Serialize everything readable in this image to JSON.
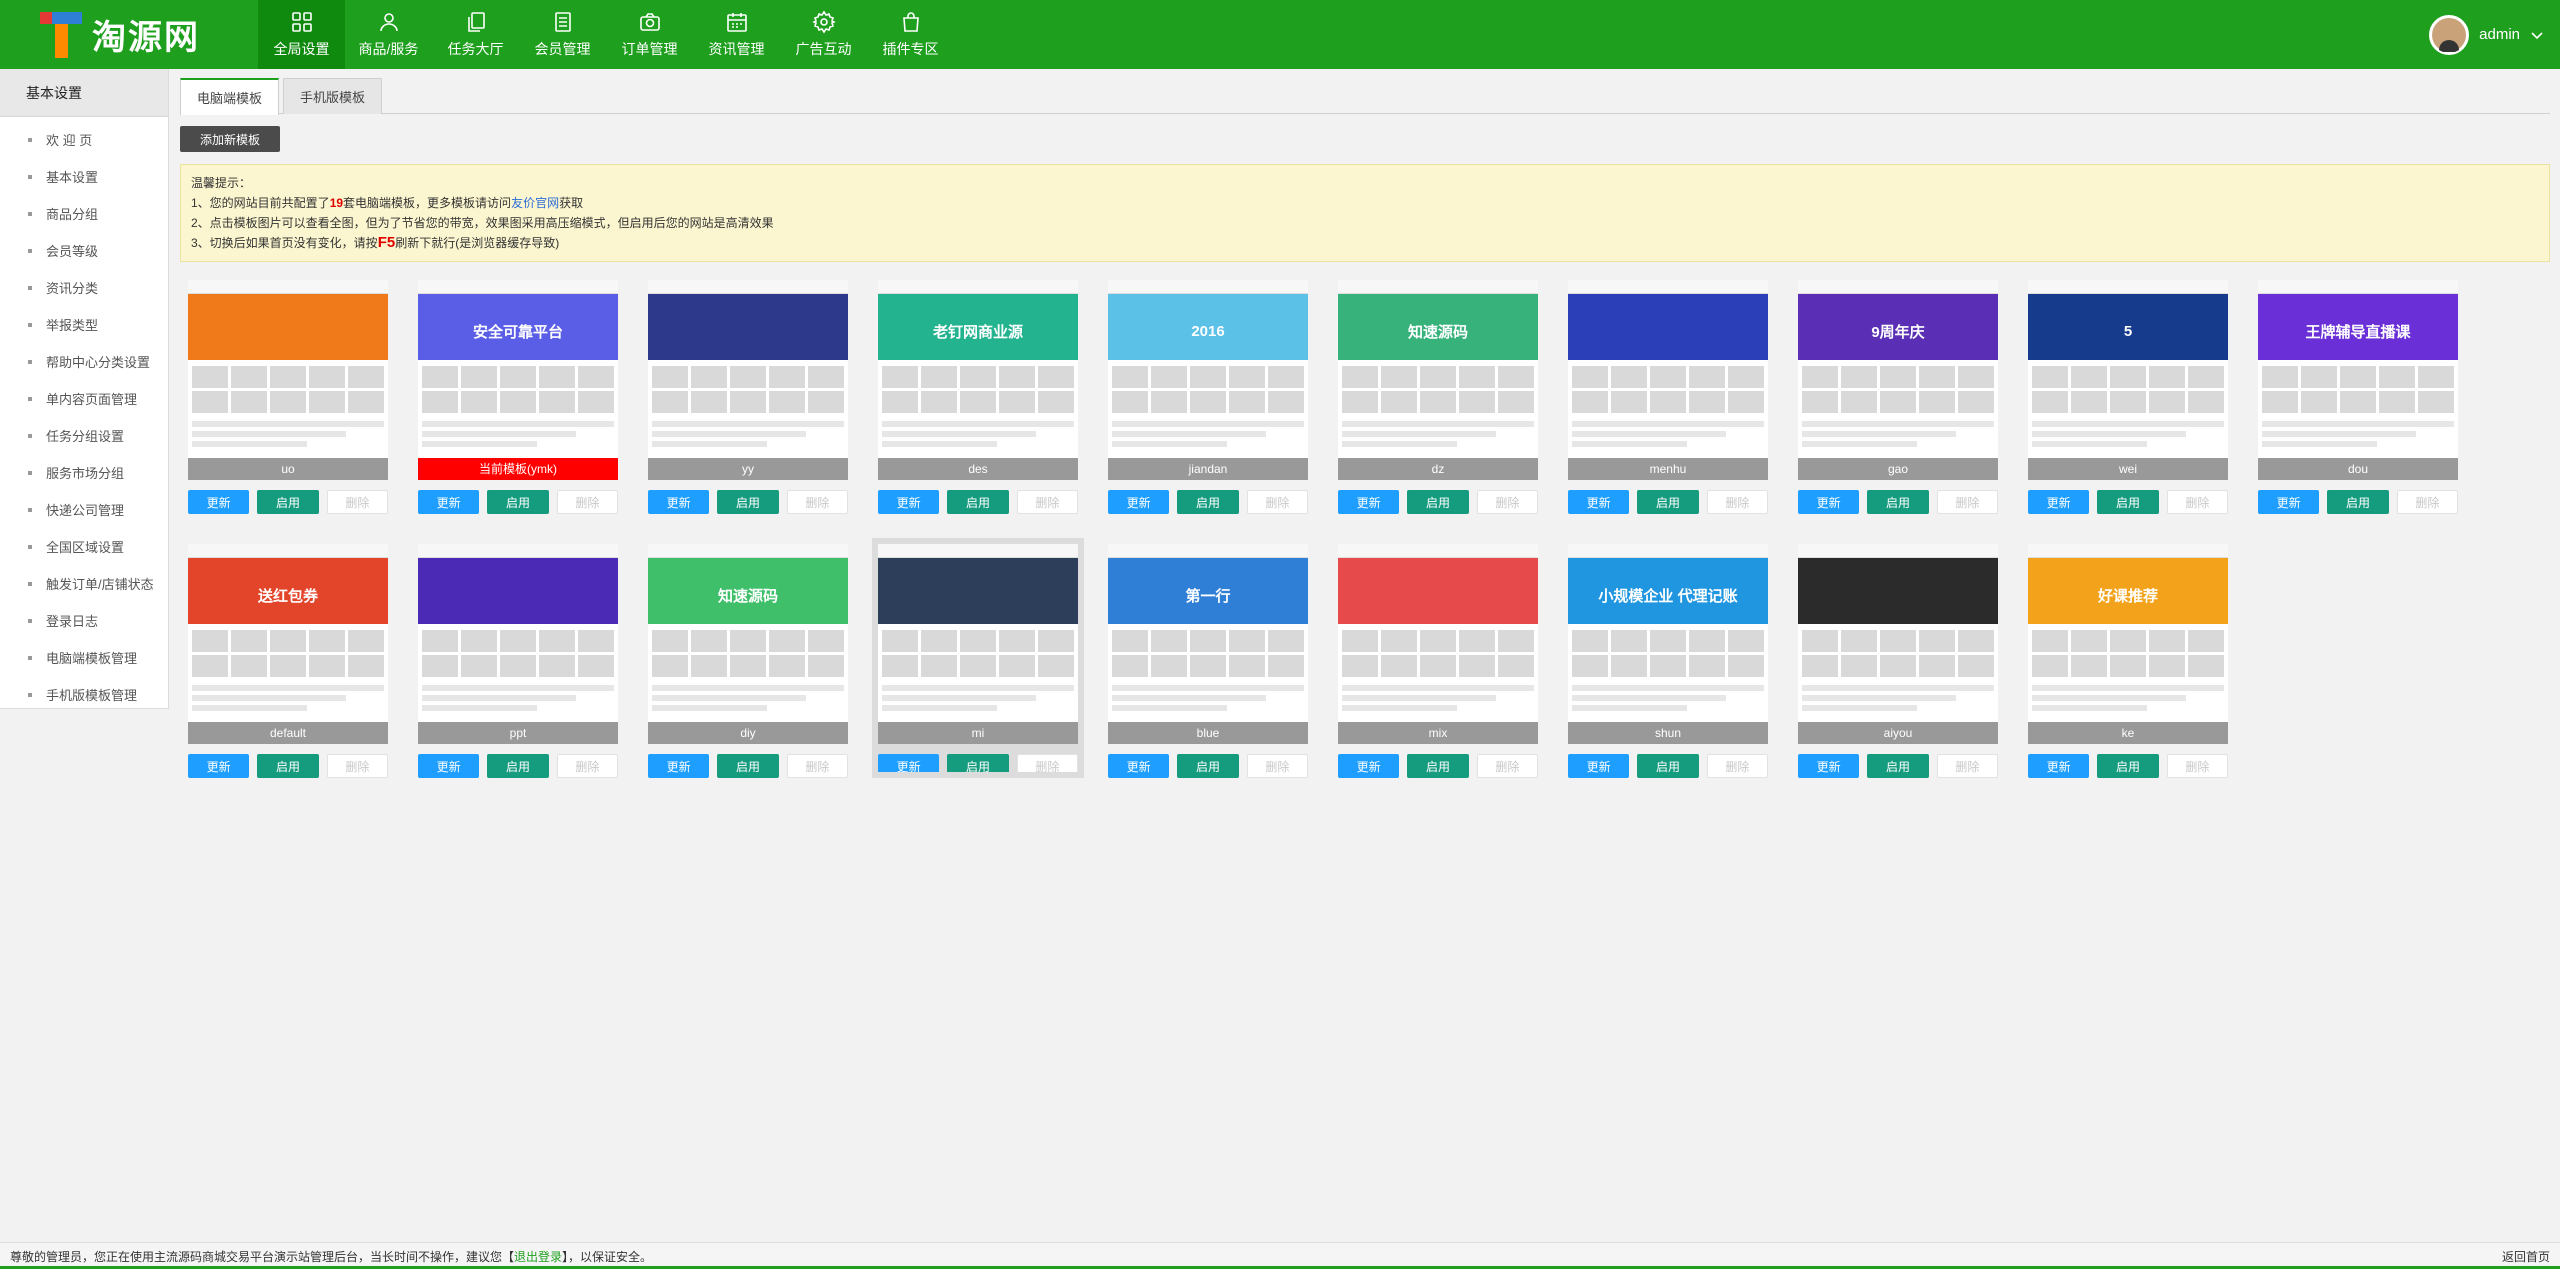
{
  "brand": {
    "name": "淘源网"
  },
  "nav": [
    {
      "label": "全局设置",
      "icon": "grid-icon",
      "active": true
    },
    {
      "label": "商品/服务",
      "icon": "user-icon",
      "active": false
    },
    {
      "label": "任务大厅",
      "icon": "copy-icon",
      "active": false
    },
    {
      "label": "会员管理",
      "icon": "list-icon",
      "active": false
    },
    {
      "label": "订单管理",
      "icon": "camera-icon",
      "active": false
    },
    {
      "label": "资讯管理",
      "icon": "calendar-icon",
      "active": false
    },
    {
      "label": "广告互动",
      "icon": "gear-icon",
      "active": false
    },
    {
      "label": "插件专区",
      "icon": "bag-icon",
      "active": false
    }
  ],
  "user": {
    "name": "admin"
  },
  "sidebar": {
    "title": "基本设置",
    "items": [
      "欢 迎 页",
      "基本设置",
      "商品分组",
      "会员等级",
      "资讯分类",
      "举报类型",
      "帮助中心分类设置",
      "单内容页面管理",
      "任务分组设置",
      "服务市场分组",
      "快递公司管理",
      "全国区域设置",
      "触发订单/店铺状态",
      "登录日志",
      "电脑端模板管理",
      "手机版模板管理"
    ]
  },
  "tabs": {
    "pc": "电脑端模板",
    "mobile": "手机版模板"
  },
  "add_button": "添加新模板",
  "notice": {
    "title": "温馨提示：",
    "line1_pre": "1、您的网站目前共配置了",
    "line1_count": "19",
    "line1_mid": "套电脑端模板，更多模板请访问",
    "line1_link": "友价官网",
    "line1_post": "获取",
    "line2": "2、点击模板图片可以查看全图，但为了节省您的带宽，效果图采用高压缩模式，但启用后您的网站是高清效果",
    "line3_pre": "3、切换后如果首页没有变化，请按",
    "line3_key": "F5",
    "line3_post": "刷新下就行(是浏览器缓存导致)"
  },
  "buttons": {
    "update": "更新",
    "enable": "启用",
    "delete": "删除"
  },
  "templates": [
    {
      "name": "uo",
      "color": "#f07a1a",
      "banner": "",
      "current": false,
      "selected": false
    },
    {
      "name": "当前模板(ymk)",
      "color": "#5a5de6",
      "banner": "安全可靠平台",
      "current": true,
      "selected": false
    },
    {
      "name": "yy",
      "color": "#2d3a8c",
      "banner": "",
      "current": false,
      "selected": false
    },
    {
      "name": "des",
      "color": "#24b38f",
      "banner": "老钉网商业源",
      "current": false,
      "selected": false
    },
    {
      "name": "jiandan",
      "color": "#5bc1e6",
      "banner": "2016",
      "current": false,
      "selected": false
    },
    {
      "name": "dz",
      "color": "#37b27a",
      "banner": "知速源码",
      "current": false,
      "selected": false
    },
    {
      "name": "menhu",
      "color": "#2a3fb8",
      "banner": "",
      "current": false,
      "selected": false
    },
    {
      "name": "gao",
      "color": "#5a2fb5",
      "banner": "9周年庆",
      "current": false,
      "selected": false
    },
    {
      "name": "wei",
      "color": "#173b8c",
      "banner": "5",
      "current": false,
      "selected": false
    },
    {
      "name": "dou",
      "color": "#6a2fd6",
      "banner": "王牌辅导直播课",
      "current": false,
      "selected": false
    },
    {
      "name": "default",
      "color": "#e3452b",
      "banner": "送红包券",
      "current": false,
      "selected": false
    },
    {
      "name": "ppt",
      "color": "#4b2ab5",
      "banner": "",
      "current": false,
      "selected": false
    },
    {
      "name": "diy",
      "color": "#3fbf6a",
      "banner": "知速源码",
      "current": false,
      "selected": false
    },
    {
      "name": "mi",
      "color": "#2c3e5a",
      "banner": "",
      "current": false,
      "selected": true
    },
    {
      "name": "blue",
      "color": "#2f7fd6",
      "banner": "第一行",
      "current": false,
      "selected": false
    },
    {
      "name": "mix",
      "color": "#e64a4a",
      "banner": "",
      "current": false,
      "selected": false
    },
    {
      "name": "shun",
      "color": "#2196e0",
      "banner": "小规模企业 代理记账",
      "current": false,
      "selected": false
    },
    {
      "name": "aiyou",
      "color": "#2b2b2b",
      "banner": "",
      "current": false,
      "selected": false
    },
    {
      "name": "ke",
      "color": "#ffffff",
      "banner": "好课推荐",
      "current": false,
      "selected": false
    }
  ],
  "footer": {
    "text_pre": "尊敬的管理员，您正在使用主流源码商城交易平台演示站管理后台，当长时间不操作，建议您【",
    "logout": "退出登录",
    "text_post": "】，以保证安全。",
    "back_home": "返回首页"
  }
}
